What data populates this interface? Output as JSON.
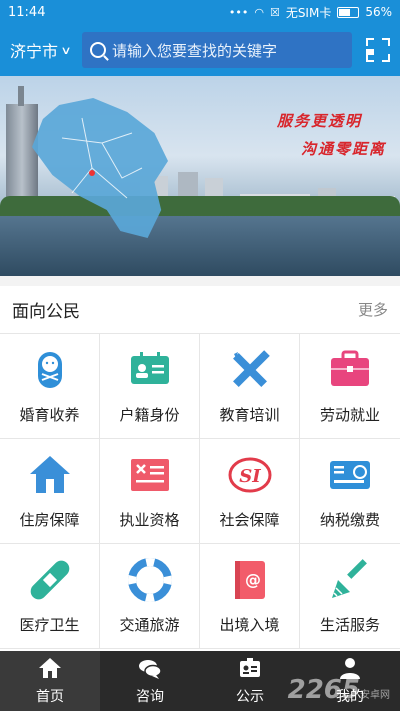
{
  "status_bar": {
    "time": "11:44",
    "network_label": "无SIM卡",
    "battery": "56%"
  },
  "header": {
    "city": "济宁市",
    "search_placeholder": "请输入您要查找的关键字"
  },
  "banner": {
    "slogan_line1": "服务更透明",
    "slogan_line2": "沟通零距离"
  },
  "section": {
    "title": "面向公民",
    "more": "更多",
    "items": [
      {
        "label": "婚育收养",
        "icon": "baby-icon",
        "color": "#2f8fd8"
      },
      {
        "label": "户籍身份",
        "icon": "id-card-icon",
        "color": "#2fb29a"
      },
      {
        "label": "教育培训",
        "icon": "pencil-ruler-icon",
        "color": "#3a8fd8"
      },
      {
        "label": "劳动就业",
        "icon": "briefcase-icon",
        "color": "#e8457e"
      },
      {
        "label": "住房保障",
        "icon": "house-icon",
        "color": "#3a8fd8"
      },
      {
        "label": "执业资格",
        "icon": "certificate-icon",
        "color": "#ef5a6a"
      },
      {
        "label": "社会保障",
        "icon": "social-security-icon",
        "color": "#e23b4a"
      },
      {
        "label": "纳税缴费",
        "icon": "tax-card-icon",
        "color": "#2f8fd8"
      },
      {
        "label": "医疗卫生",
        "icon": "bandage-icon",
        "color": "#2fb29a"
      },
      {
        "label": "交通旅游",
        "icon": "lifebuoy-icon",
        "color": "#3a8fd8"
      },
      {
        "label": "出境入境",
        "icon": "passport-icon",
        "color": "#f25c6a"
      },
      {
        "label": "生活服务",
        "icon": "brush-icon",
        "color": "#2fb29a"
      }
    ]
  },
  "tabs": [
    {
      "label": "首页",
      "icon": "home-icon"
    },
    {
      "label": "咨询",
      "icon": "chat-icon"
    },
    {
      "label": "公示",
      "icon": "notice-board-icon"
    },
    {
      "label": "我的",
      "icon": "user-icon"
    }
  ],
  "watermark": {
    "text": "2265",
    "subtext": "安卓网"
  }
}
